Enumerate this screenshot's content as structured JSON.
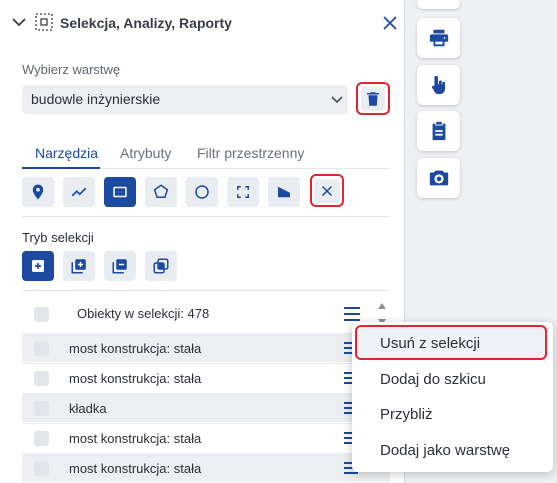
{
  "panel": {
    "title": "Selekcja, Analizy, Raporty"
  },
  "layer": {
    "label": "Wybierz warstwę",
    "selected": "budowle inżynierskie"
  },
  "tabs": [
    {
      "label": "Narzędzia",
      "active": true
    },
    {
      "label": "Atrybuty",
      "active": false
    },
    {
      "label": "Filtr przestrzenny",
      "active": false
    }
  ],
  "tools": [
    {
      "icon": "map-pin-icon",
      "active": false
    },
    {
      "icon": "polyline-icon",
      "active": false
    },
    {
      "icon": "rectangle-icon",
      "active": true
    },
    {
      "icon": "polygon-icon",
      "active": false
    },
    {
      "icon": "circle-icon",
      "active": false
    },
    {
      "icon": "extent-icon",
      "active": false
    },
    {
      "icon": "flag-shape-icon",
      "active": false
    },
    {
      "icon": "clear-x-icon",
      "active": false
    }
  ],
  "mode": {
    "label": "Tryb selekcji",
    "items": [
      {
        "icon": "new-selection-icon",
        "active": true
      },
      {
        "icon": "add-to-selection-icon",
        "active": false
      },
      {
        "icon": "remove-from-selection-icon",
        "active": false
      },
      {
        "icon": "intersect-selection-icon",
        "active": false
      }
    ]
  },
  "list": {
    "header": "Obiekty w selekcji: 478",
    "rows": [
      "most konstrukcja: stała",
      "most konstrukcja: stała",
      "kładka",
      "most konstrukcja: stała",
      "most konstrukcja: stała"
    ]
  },
  "context_menu": {
    "items": [
      {
        "label": "Usuń z selekcji",
        "highlighted": true
      },
      {
        "label": "Dodaj do szkicu",
        "highlighted": false
      },
      {
        "label": "Przybliż",
        "highlighted": false
      },
      {
        "label": "Dodaj jako warstwę",
        "highlighted": false
      }
    ]
  },
  "rail": [
    "print-icon",
    "touch-icon",
    "clipboard-icon",
    "camera-icon"
  ],
  "colors": {
    "accent": "#1b4aa0",
    "danger": "#e0252c",
    "muted": "#eceef1"
  }
}
